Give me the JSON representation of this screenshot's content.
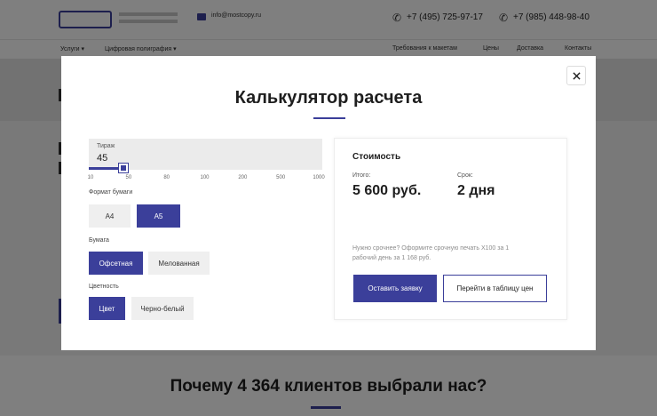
{
  "background": {
    "email": "info@mostcopy.ru",
    "phones": [
      "+7 (495) 725-97-17",
      "+7 (985) 448-98-40"
    ],
    "nav_items": [
      "Услуги ▾",
      "Цифровая полиграфия ▾",
      "Требования к макетам",
      "Цены",
      "Доставка",
      "Контакты"
    ],
    "section_heading": "Почему 4 364 клиентов выбрали нас?"
  },
  "modal": {
    "title": "Калькулятор расчета",
    "close_icon": "close-icon",
    "circulation": {
      "label": "Тираж",
      "value": "45",
      "level": 45,
      "ticks": [
        "10",
        "50",
        "80",
        "100",
        "200",
        "500",
        "1000"
      ]
    },
    "format": {
      "label": "Формат бумаги",
      "options": [
        {
          "label": "А4",
          "active": false
        },
        {
          "label": "А5",
          "active": true
        }
      ]
    },
    "paper": {
      "label": "Бумага",
      "options": [
        {
          "label": "Офсетная",
          "active": true
        },
        {
          "label": "Мелованная",
          "active": false
        }
      ]
    },
    "color": {
      "label": "Цветность",
      "options": [
        {
          "label": "Цвет",
          "active": true
        },
        {
          "label": "Черно-белый",
          "active": false
        }
      ]
    },
    "cost": {
      "title": "Стоимость",
      "total_label": "Итого:",
      "total_value": "5 600 руб.",
      "term_label": "Срок:",
      "term_value": "2 дня",
      "note": "Нужно срочнее? Оформите срочную печать X100 за 1 рабочий день за 1 168 руб.",
      "order_button": "Оставить заявку",
      "table_button": "Перейти в таблицу цен"
    }
  },
  "colors": {
    "accent": "#3b3f9a",
    "overlay": "rgba(0,0,0,0.5)"
  }
}
